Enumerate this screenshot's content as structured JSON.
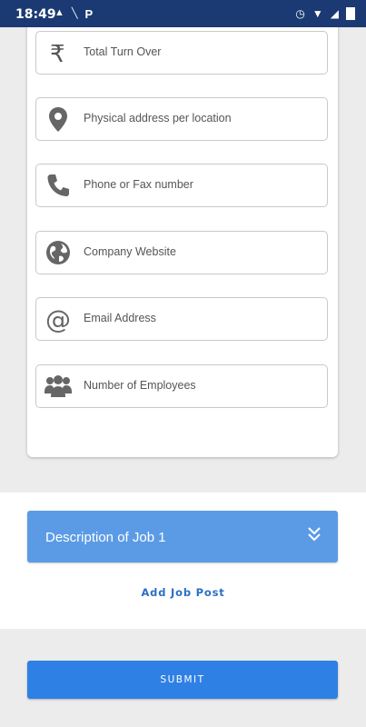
{
  "status_bar": {
    "time": "18:49",
    "icons_left": [
      "sim-icon",
      "signal-off-icon",
      "p-icon"
    ],
    "icons_right": [
      "alarm-icon",
      "wifi-icon",
      "signal-icon",
      "battery-icon"
    ]
  },
  "form": {
    "fields": [
      {
        "placeholder": "Total Turn Over",
        "icon": "rupee-icon"
      },
      {
        "placeholder": "Physical address per location",
        "icon": "location-pin-icon"
      },
      {
        "placeholder": "Phone or Fax number",
        "icon": "phone-icon"
      },
      {
        "placeholder": "Company Website",
        "icon": "globe-icon"
      },
      {
        "placeholder": "Email Address",
        "icon": "at-icon"
      },
      {
        "placeholder": "Number of Employees",
        "icon": "group-icon"
      }
    ]
  },
  "job": {
    "title": "Description of Job 1",
    "add_label": "Add Job Post"
  },
  "submit_label": "SUBMIT",
  "colors": {
    "status_bar": "#1b3a73",
    "job_header": "#5b9be6",
    "submit": "#2f80e4",
    "link": "#2a6fc6"
  }
}
